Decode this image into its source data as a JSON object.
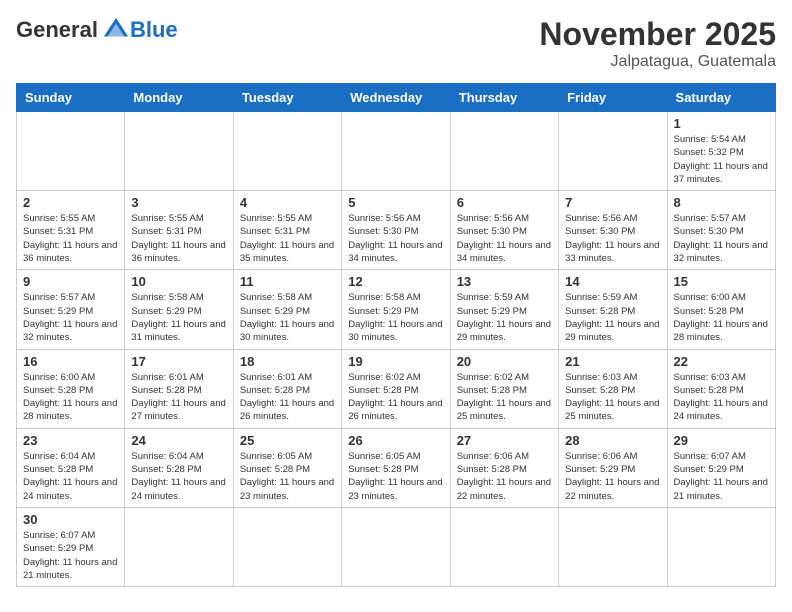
{
  "header": {
    "logo_general": "General",
    "logo_blue": "Blue",
    "month": "November 2025",
    "location": "Jalpatagua, Guatemala"
  },
  "weekdays": [
    "Sunday",
    "Monday",
    "Tuesday",
    "Wednesday",
    "Thursday",
    "Friday",
    "Saturday"
  ],
  "weeks": [
    [
      {
        "day": "",
        "info": ""
      },
      {
        "day": "",
        "info": ""
      },
      {
        "day": "",
        "info": ""
      },
      {
        "day": "",
        "info": ""
      },
      {
        "day": "",
        "info": ""
      },
      {
        "day": "",
        "info": ""
      },
      {
        "day": "1",
        "info": "Sunrise: 5:54 AM\nSunset: 5:32 PM\nDaylight: 11 hours and 37 minutes."
      }
    ],
    [
      {
        "day": "2",
        "info": "Sunrise: 5:55 AM\nSunset: 5:31 PM\nDaylight: 11 hours and 36 minutes."
      },
      {
        "day": "3",
        "info": "Sunrise: 5:55 AM\nSunset: 5:31 PM\nDaylight: 11 hours and 36 minutes."
      },
      {
        "day": "4",
        "info": "Sunrise: 5:55 AM\nSunset: 5:31 PM\nDaylight: 11 hours and 35 minutes."
      },
      {
        "day": "5",
        "info": "Sunrise: 5:56 AM\nSunset: 5:30 PM\nDaylight: 11 hours and 34 minutes."
      },
      {
        "day": "6",
        "info": "Sunrise: 5:56 AM\nSunset: 5:30 PM\nDaylight: 11 hours and 34 minutes."
      },
      {
        "day": "7",
        "info": "Sunrise: 5:56 AM\nSunset: 5:30 PM\nDaylight: 11 hours and 33 minutes."
      },
      {
        "day": "8",
        "info": "Sunrise: 5:57 AM\nSunset: 5:30 PM\nDaylight: 11 hours and 32 minutes."
      }
    ],
    [
      {
        "day": "9",
        "info": "Sunrise: 5:57 AM\nSunset: 5:29 PM\nDaylight: 11 hours and 32 minutes."
      },
      {
        "day": "10",
        "info": "Sunrise: 5:58 AM\nSunset: 5:29 PM\nDaylight: 11 hours and 31 minutes."
      },
      {
        "day": "11",
        "info": "Sunrise: 5:58 AM\nSunset: 5:29 PM\nDaylight: 11 hours and 30 minutes."
      },
      {
        "day": "12",
        "info": "Sunrise: 5:58 AM\nSunset: 5:29 PM\nDaylight: 11 hours and 30 minutes."
      },
      {
        "day": "13",
        "info": "Sunrise: 5:59 AM\nSunset: 5:29 PM\nDaylight: 11 hours and 29 minutes."
      },
      {
        "day": "14",
        "info": "Sunrise: 5:59 AM\nSunset: 5:28 PM\nDaylight: 11 hours and 29 minutes."
      },
      {
        "day": "15",
        "info": "Sunrise: 6:00 AM\nSunset: 5:28 PM\nDaylight: 11 hours and 28 minutes."
      }
    ],
    [
      {
        "day": "16",
        "info": "Sunrise: 6:00 AM\nSunset: 5:28 PM\nDaylight: 11 hours and 28 minutes."
      },
      {
        "day": "17",
        "info": "Sunrise: 6:01 AM\nSunset: 5:28 PM\nDaylight: 11 hours and 27 minutes."
      },
      {
        "day": "18",
        "info": "Sunrise: 6:01 AM\nSunset: 5:28 PM\nDaylight: 11 hours and 26 minutes."
      },
      {
        "day": "19",
        "info": "Sunrise: 6:02 AM\nSunset: 5:28 PM\nDaylight: 11 hours and 26 minutes."
      },
      {
        "day": "20",
        "info": "Sunrise: 6:02 AM\nSunset: 5:28 PM\nDaylight: 11 hours and 25 minutes."
      },
      {
        "day": "21",
        "info": "Sunrise: 6:03 AM\nSunset: 5:28 PM\nDaylight: 11 hours and 25 minutes."
      },
      {
        "day": "22",
        "info": "Sunrise: 6:03 AM\nSunset: 5:28 PM\nDaylight: 11 hours and 24 minutes."
      }
    ],
    [
      {
        "day": "23",
        "info": "Sunrise: 6:04 AM\nSunset: 5:28 PM\nDaylight: 11 hours and 24 minutes."
      },
      {
        "day": "24",
        "info": "Sunrise: 6:04 AM\nSunset: 5:28 PM\nDaylight: 11 hours and 24 minutes."
      },
      {
        "day": "25",
        "info": "Sunrise: 6:05 AM\nSunset: 5:28 PM\nDaylight: 11 hours and 23 minutes."
      },
      {
        "day": "26",
        "info": "Sunrise: 6:05 AM\nSunset: 5:28 PM\nDaylight: 11 hours and 23 minutes."
      },
      {
        "day": "27",
        "info": "Sunrise: 6:06 AM\nSunset: 5:28 PM\nDaylight: 11 hours and 22 minutes."
      },
      {
        "day": "28",
        "info": "Sunrise: 6:06 AM\nSunset: 5:29 PM\nDaylight: 11 hours and 22 minutes."
      },
      {
        "day": "29",
        "info": "Sunrise: 6:07 AM\nSunset: 5:29 PM\nDaylight: 11 hours and 21 minutes."
      }
    ],
    [
      {
        "day": "30",
        "info": "Sunrise: 6:07 AM\nSunset: 5:29 PM\nDaylight: 11 hours and 21 minutes."
      },
      {
        "day": "",
        "info": ""
      },
      {
        "day": "",
        "info": ""
      },
      {
        "day": "",
        "info": ""
      },
      {
        "day": "",
        "info": ""
      },
      {
        "day": "",
        "info": ""
      },
      {
        "day": "",
        "info": ""
      }
    ]
  ]
}
